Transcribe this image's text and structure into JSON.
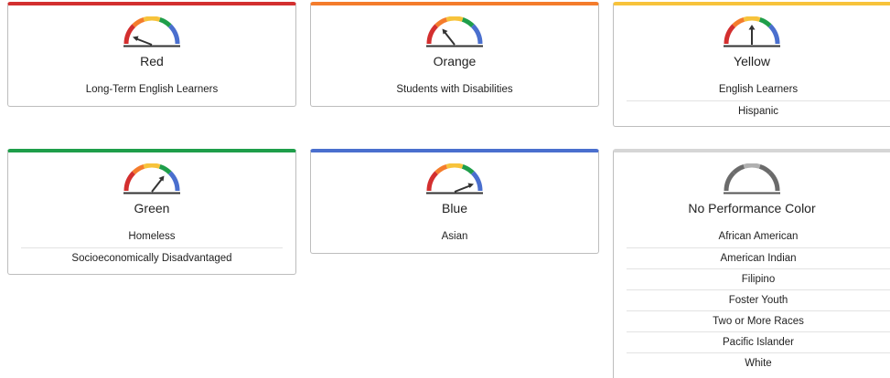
{
  "cards": [
    {
      "title": "Red",
      "accent": "#d32f2f",
      "groups": [
        "Long-Term English Learners"
      ]
    },
    {
      "title": "Orange",
      "accent": "#f47c2c",
      "groups": [
        "Students with Disabilities"
      ]
    },
    {
      "title": "Yellow",
      "accent": "#f7c33b",
      "groups": [
        "English Learners",
        "Hispanic"
      ]
    },
    {
      "title": "Green",
      "accent": "#1e9e4a",
      "groups": [
        "Homeless",
        "Socioeconomically Disadvantaged"
      ]
    },
    {
      "title": "Blue",
      "accent": "#4a6fce",
      "groups": [
        "Asian"
      ]
    },
    {
      "title": "No Performance Color",
      "accent": "#d6d6d6",
      "groups": [
        "African American",
        "American Indian",
        "Filipino",
        "Foster Youth",
        "Two or More Races",
        "Pacific Islander",
        "White"
      ]
    }
  ],
  "gauge_colors": {
    "red": "#d32f2f",
    "orange": "#f47c2c",
    "yellow": "#f7c33b",
    "green": "#1e9e4a",
    "blue": "#4a6fce",
    "gray_dark": "#6b6b6b",
    "gray_light": "#b0b0b0",
    "needle": "#333333"
  }
}
